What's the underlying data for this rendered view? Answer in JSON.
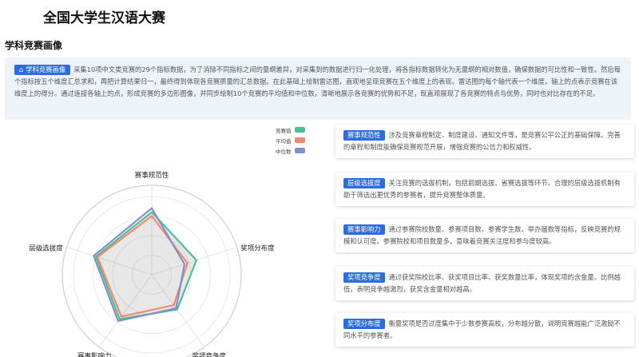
{
  "page_title": "全国大学生汉语大赛",
  "section_title": "学科竞赛画像",
  "intro": {
    "badge": "学科竞赛画像",
    "icon": "home-icon",
    "text": "采集10项中文类竞赛的29个指标数据，为了消除不同指标之间的量纲差异，对采集到的数据进行归一化处理，将各指标数据转化为无量纲的相对数值，确保数据的可比性和一致性。然后每个指标按五个维度汇总求和，再把计算结果归一，最终得到体现各竞赛质量的汇总数据。在此基础上绘制雷达图，直观地呈现竞赛在五个维度上的表现。雷达图的每个轴代表一个维度，轴上的点表示竞赛在该维度上的得分。通过连接各轴上的点，形成竞赛的多边形图像，并同步绘制10个竞赛的平均值和中位数，清晰地展示各竞赛的优势和不足，既直观展现了各竞赛的特点与优势，同时也对比存在的不足。"
  },
  "legend": [
    {
      "label": "竞赛值",
      "color": "#4dbf97"
    },
    {
      "label": "平均值",
      "color": "#f08a6c"
    },
    {
      "label": "中位数",
      "color": "#7f90cc"
    }
  ],
  "chart_data": {
    "type": "radar",
    "axes": [
      "赛事规范性",
      "奖项分布度",
      "奖项竞争度",
      "赛事影响力",
      "层级选拔度"
    ],
    "rmax": 1.0,
    "rings": 4,
    "series": [
      {
        "name": "竞赛值",
        "color": "#4dbf97",
        "values": [
          0.8,
          0.6,
          0.55,
          0.7,
          0.75
        ]
      },
      {
        "name": "平均值",
        "color": "#f08a6c",
        "values": [
          0.75,
          0.48,
          0.48,
          0.66,
          0.73
        ]
      },
      {
        "name": "中位数",
        "color": "#7f90cc",
        "values": [
          0.85,
          0.44,
          0.53,
          0.73,
          0.78
        ]
      }
    ]
  },
  "cards": [
    {
      "badge": "赛事规范性",
      "text": "涉及竞赛章程制定、制度建设、通知文件等，是竞赛公平公正的基础保障。完善的章程和制度能确保竞赛规范开展，增强竞赛的公信力和权威性。"
    },
    {
      "badge": "层级选拔度",
      "text": "关注竞赛的选拔机制，包括前期选拔、省赛选拔等环节。合理的层级选拔机制有助于筛选出更优秀的参赛者，提升竞赛整体质量。"
    },
    {
      "badge": "赛事影响力",
      "text": "通过参赛院校数量、参赛项目数、参赛学生数、举办届数等指标，反映竞赛的规模和认可度。参赛院校和项目数量多，意味着竞赛关注度和参与度较高。"
    },
    {
      "badge": "奖项竞争度",
      "text": "通过获奖院校比率、获奖项目比率、获奖数量比率，体现奖项的含金量。比例越低，表明竞争越激烈，获奖含金量相对越高。"
    },
    {
      "badge": "奖项分布度",
      "text": "衡量奖项是否过度集中于少数参赛高校，分布越分散，说明竞赛越能广泛激励不同水平的参赛者。"
    }
  ]
}
